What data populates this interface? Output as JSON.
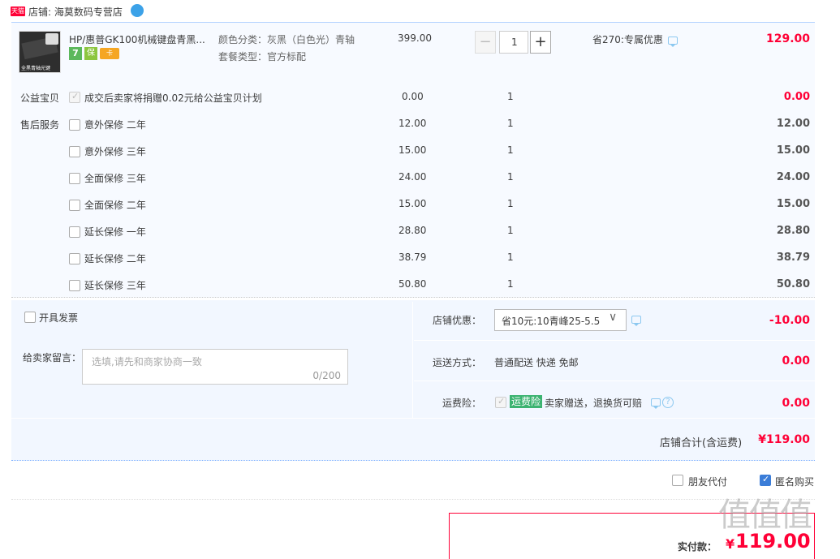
{
  "shop": {
    "badge": "天猫",
    "name": "店铺: 海莫数码专营店"
  },
  "item": {
    "title": "HP/惠普GK100机械键盘青黑...",
    "thumb_text": "全黑青轴光键",
    "attr1": "颜色分类：灰黑（白色光）青轴",
    "attr2": "套餐类型：官方标配",
    "unit_price": "399.00",
    "qty": "1",
    "discount": "省270:专属优惠",
    "subtotal": "129.00",
    "badges": [
      "7",
      "保",
      "卡"
    ]
  },
  "charity": {
    "label": "公益宝贝",
    "text": "成交后卖家将捐赠0.02元给公益宝贝计划",
    "price": "0.00",
    "qty": "1",
    "total": "0.00"
  },
  "services": {
    "label": "售后服务",
    "rows": [
      {
        "name": "意外保修 二年",
        "price": "12.00",
        "qty": "1",
        "total": "12.00"
      },
      {
        "name": "意外保修 三年",
        "price": "15.00",
        "qty": "1",
        "total": "15.00"
      },
      {
        "name": "全面保修 三年",
        "price": "24.00",
        "qty": "1",
        "total": "24.00"
      },
      {
        "name": "全面保修 二年",
        "price": "15.00",
        "qty": "1",
        "total": "15.00"
      },
      {
        "name": "延长保修 一年",
        "price": "28.80",
        "qty": "1",
        "total": "28.80"
      },
      {
        "name": "延长保修 二年",
        "price": "38.79",
        "qty": "1",
        "total": "38.79"
      },
      {
        "name": "延长保修 三年",
        "price": "50.80",
        "qty": "1",
        "total": "50.80"
      }
    ]
  },
  "invoice_label": "开具发票",
  "message": {
    "label": "给卖家留言：",
    "placeholder": "选填,请先和商家协商一致",
    "counter": "0/200"
  },
  "coupon": {
    "label": "店铺优惠：",
    "selected": "省10元:10青峰25-5.5",
    "amount": "-10.00"
  },
  "shipping": {
    "label": "运送方式：",
    "value": "普通配送 快递 免邮",
    "amount": "0.00"
  },
  "insurance": {
    "label": "运费险：",
    "tag": "运费险",
    "text": "卖家赠送，退换货可赔",
    "amount": "0.00"
  },
  "shop_total": {
    "label": "店铺合计(含运费)",
    "value": "¥119.00"
  },
  "options": {
    "friend_pay": "朋友代付",
    "anonymous": "匿名购买"
  },
  "pay": {
    "label": "实付款：",
    "currency": "¥",
    "amount": "119.00"
  },
  "watermark": "值值值"
}
